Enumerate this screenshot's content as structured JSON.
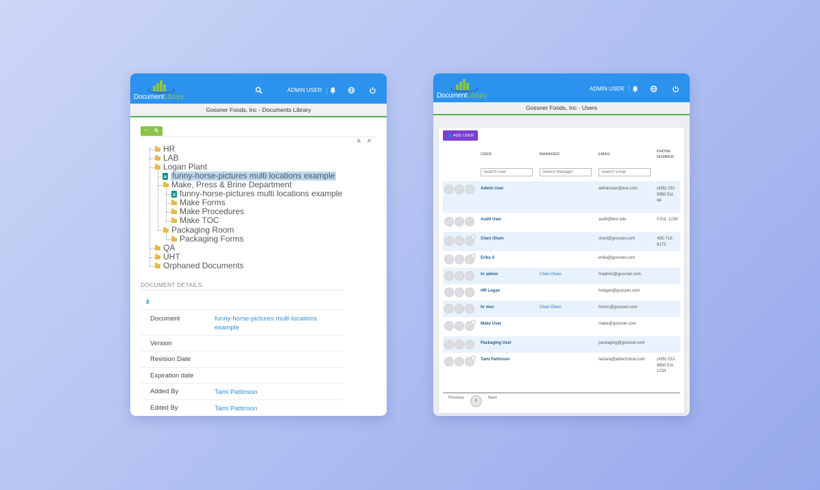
{
  "left_panel": {
    "header": {
      "logo_word1": "Document",
      "logo_word2": "Library",
      "user_label": "ADMIN USER"
    },
    "subtitle": "Gossner Foods, Inc - Documents Library",
    "toolbar": {
      "add_icon": "plus-icon",
      "search_icon": "search-icon"
    },
    "font_controls": [
      "A",
      "A"
    ],
    "tree": [
      {
        "label": "HR",
        "icon": "folder-icon"
      },
      {
        "label": "LAB",
        "icon": "folder-icon"
      },
      {
        "label": "Logan Plant",
        "icon": "folder-icon",
        "expanded": true
      },
      {
        "label": "funny-horse-pictures multi locations example",
        "icon": "document-icon",
        "selected": true
      },
      {
        "label": "Make, Press & Brine Department",
        "icon": "folder-icon",
        "expanded": true
      },
      {
        "label": "funny-horse-pictures multi locations example",
        "icon": "document-icon"
      },
      {
        "label": "Make Forms",
        "icon": "folder-icon"
      },
      {
        "label": "Make Procedures",
        "icon": "folder-icon"
      },
      {
        "label": "Make TOC",
        "icon": "folder-icon"
      },
      {
        "label": "Packaging Room",
        "icon": "folder-icon",
        "expanded": true
      },
      {
        "label": "Packaging Forms",
        "icon": "folder-icon"
      },
      {
        "label": "QA",
        "icon": "folder-icon"
      },
      {
        "label": "UHT",
        "icon": "folder-icon"
      },
      {
        "label": "Orphaned Documents",
        "icon": "folder-icon"
      }
    ],
    "details": {
      "title": "DOCUMENT DETAILS",
      "download_icon": "download-icon",
      "rows": [
        {
          "key": "Document",
          "value": "funny-horse-pictures multi locations example"
        },
        {
          "key": "Version",
          "value": ""
        },
        {
          "key": "Revision Date",
          "value": ""
        },
        {
          "key": "Expiration date",
          "value": ""
        },
        {
          "key": "Added By",
          "value": "Tami Pattinson"
        },
        {
          "key": "Edited By",
          "value": "Tami Pattinson"
        }
      ]
    }
  },
  "right_panel": {
    "header": {
      "logo_word1": "Document",
      "logo_word2": "Library",
      "user_label": "ADMIN USER"
    },
    "subtitle": "Gossner Foods, Inc - Users",
    "add_user_label": "ADD USER",
    "columns": {
      "user": "USER",
      "manager": "MANAGER",
      "email": "EMAIL",
      "phone": "PHONE NUMBER"
    },
    "search": {
      "user_placeholder": "Search User",
      "manager_placeholder": "Search Manager",
      "email_placeholder": "Search Email"
    },
    "users": [
      {
        "name": "Admin User",
        "manager": "",
        "email": "adminuser@test.com",
        "phone": "(435) 232- 9950 Ext. qa"
      },
      {
        "name": "Audit User",
        "manager": "",
        "email": "audit@test.edu",
        "phone": "0 Ext. 1234"
      },
      {
        "name": "Cheri Olsen",
        "manager": "",
        "email": "cheri@gossner.com",
        "phone": "435-713- 6173"
      },
      {
        "name": "Erika S",
        "manager": "",
        "email": "erika@gossner.com",
        "phone": ""
      },
      {
        "name": "hr admin",
        "manager": "Cheri Olsen",
        "email": "hradmin@gossner.com",
        "phone": ""
      },
      {
        "name": "HR Logan",
        "manager": "",
        "email": "hrlogan@gossner.com",
        "phone": ""
      },
      {
        "name": "hr mvc",
        "manager": "Cheri Olsen",
        "email": "hrmvc@gossner.com",
        "phone": ""
      },
      {
        "name": "Make User",
        "manager": "",
        "email": "make@gossner.com",
        "phone": ""
      },
      {
        "name": "Packaging User",
        "manager": "",
        "email": "packaging@gossner.com",
        "phone": ""
      },
      {
        "name": "Tami Pattinson",
        "manager": "",
        "email": "tamara@jettechnical.com",
        "phone": "(435) 232- 9950 Ext. 1234"
      }
    ],
    "pager": {
      "previous": "Previous",
      "page": "1",
      "next": "Next"
    }
  },
  "colors": {
    "header_blue": "#2b92ee",
    "logo_green": "#8cc63f",
    "accent_green": "#4caf50",
    "add_user_purple": "#7c3fcf",
    "link_blue": "#2b8fdc"
  }
}
